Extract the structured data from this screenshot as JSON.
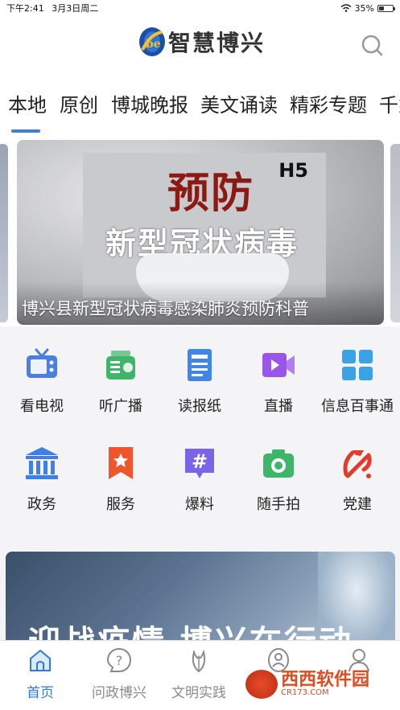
{
  "status_bar": {
    "time": "下午2:41",
    "date": "3月3日周二",
    "battery": "35%",
    "battery_level": 0.35
  },
  "header": {
    "brand": "智慧博兴"
  },
  "tabs": [
    {
      "label": "本地",
      "active": true
    },
    {
      "label": "原创"
    },
    {
      "label": "博城晚报"
    },
    {
      "label": "美文诵读"
    },
    {
      "label": "精彩专题"
    },
    {
      "label": "千乘"
    }
  ],
  "banner": {
    "caption": "博兴县新型冠状病毒感染肺炎预防科普",
    "poster_title": "预防",
    "poster_subtitle": "新型冠状病毒",
    "poster_badge": "H5"
  },
  "services": [
    {
      "label": "看电视",
      "icon": "tv-icon",
      "color": "#4a7fe0"
    },
    {
      "label": "听广播",
      "icon": "radio-icon",
      "color": "#3fb56a"
    },
    {
      "label": "读报纸",
      "icon": "newspaper-icon",
      "color": "#3f86e8"
    },
    {
      "label": "直播",
      "icon": "live-video-icon",
      "color": "#9a56e8"
    },
    {
      "label": "信息百事通",
      "icon": "grid-apps-icon",
      "color": "#3aa3e6"
    },
    {
      "label": "政务",
      "icon": "government-icon",
      "color": "#3f7fe8"
    },
    {
      "label": "服务",
      "icon": "bookmark-star-icon",
      "color": "#f0562e"
    },
    {
      "label": "爆料",
      "icon": "hashtag-icon",
      "color": "#7a64e8"
    },
    {
      "label": "随手拍",
      "icon": "camera-icon",
      "color": "#3fb56a"
    },
    {
      "label": "党建",
      "icon": "party-emblem-icon",
      "color": "#e23b2a"
    }
  ],
  "news_card": {
    "headline": "迎战疫情 博兴在行动"
  },
  "tabbar": [
    {
      "label": "首页",
      "icon": "home-icon",
      "active": true
    },
    {
      "label": "问政博兴",
      "icon": "question-icon"
    },
    {
      "label": "文明实践",
      "icon": "flame-leaf-icon"
    },
    {
      "label": "",
      "icon": "person-badge-icon"
    },
    {
      "label": "",
      "icon": "profile-icon"
    }
  ],
  "watermark": {
    "main": "西西软件园",
    "sub": "CR173.COM"
  },
  "colors": {
    "accent": "#2f7ae0",
    "tab_indicator": "#3e7fd8"
  }
}
